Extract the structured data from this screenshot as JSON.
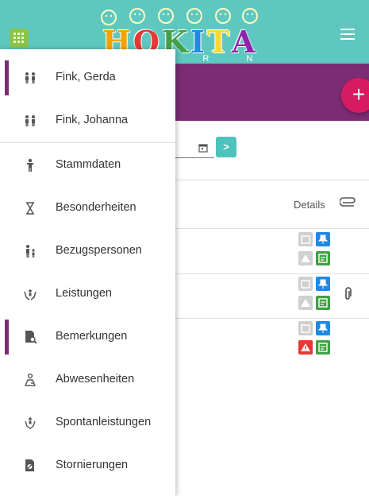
{
  "header": {
    "logo_letters": [
      "H",
      "O",
      "K",
      "I",
      "T",
      "A"
    ],
    "logo_sub": "E R N",
    "colors": {
      "teal": "#5ec8c0",
      "purple": "#7b2c73",
      "pink": "#d81b60",
      "apps_green": "#8bc34a"
    }
  },
  "banner": {
    "add_label": "+"
  },
  "date_nav": {
    "next_label": ">"
  },
  "table": {
    "details_label": "Details",
    "rows": [
      {
        "warning_active": false,
        "has_attachment": false
      },
      {
        "warning_active": false,
        "has_attachment": true
      },
      {
        "warning_active": true,
        "has_attachment": false
      }
    ]
  },
  "drawer": {
    "people": [
      {
        "label": "Fink, Gerda",
        "icon": "children-icon",
        "active": true
      },
      {
        "label": "Fink, Johanna",
        "icon": "children-icon",
        "active": false
      }
    ],
    "menu": [
      {
        "label": "Stammdaten",
        "icon": "child-icon",
        "active": false
      },
      {
        "label": "Besonderheiten",
        "icon": "hourglass-icon",
        "active": false
      },
      {
        "label": "Bezugspersonen",
        "icon": "family-icon",
        "active": false
      },
      {
        "label": "Leistungen",
        "icon": "hands-child-icon",
        "active": false
      },
      {
        "label": "Bemerkungen",
        "icon": "note-search-icon",
        "active": true
      },
      {
        "label": "Abwesenheiten",
        "icon": "person-away-icon",
        "active": false
      },
      {
        "label": "Spontanleistungen",
        "icon": "hand-child-icon",
        "active": false
      },
      {
        "label": "Stornierungen",
        "icon": "cancel-doc-icon",
        "active": false
      }
    ]
  }
}
